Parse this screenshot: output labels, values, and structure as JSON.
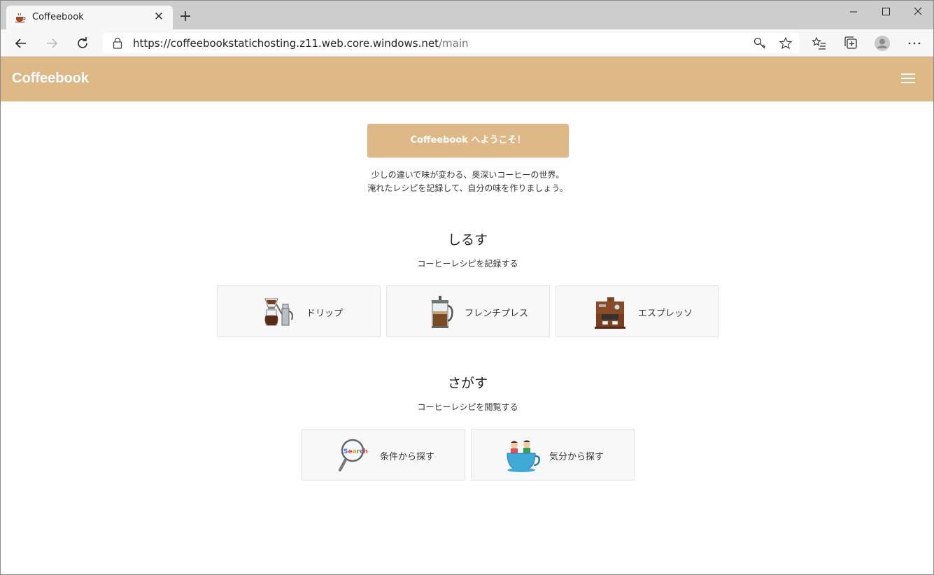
{
  "browser": {
    "tab_title": "Coffeebook",
    "url_host": "https://coffeebookstatichosting.z11.web.core.windows.net",
    "url_path": "/main"
  },
  "app": {
    "brand": "Coffeebook",
    "accent_color": "#dfb887"
  },
  "main": {
    "welcome_button": "Coffeebook へようこそ！",
    "intro_line1": "少しの違いで味が変わる、奥深いコーヒーの世界。",
    "intro_line2": "淹れたレシピを記録して、自分の味を作りましょう。",
    "record": {
      "title": "しるす",
      "subtitle": "コーヒーレシピを記録する",
      "cards": [
        {
          "label": "ドリップ",
          "icon": "drip-coffee-icon"
        },
        {
          "label": "フレンチプレス",
          "icon": "french-press-icon"
        },
        {
          "label": "エスプレッソ",
          "icon": "espresso-machine-icon"
        }
      ]
    },
    "search": {
      "title": "さがす",
      "subtitle": "コーヒーレシピを閲覧する",
      "cards": [
        {
          "label": "条件から探す",
          "icon": "magnifier-search-icon"
        },
        {
          "label": "気分から探す",
          "icon": "coffee-cup-people-icon"
        }
      ]
    }
  }
}
